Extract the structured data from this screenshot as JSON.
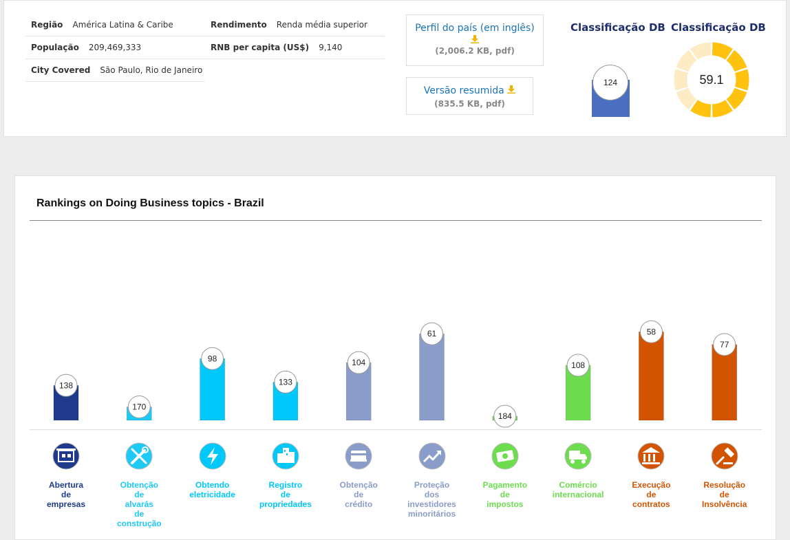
{
  "info": {
    "rows": [
      {
        "label": "Região",
        "value": "América Latina & Caribe"
      },
      {
        "label": "População",
        "value": "209,469,333"
      },
      {
        "label": "City Covered",
        "value": "São Paulo, Rio de Janeiro"
      },
      {
        "label": "Rendimento",
        "value": "Renda média superior"
      },
      {
        "label": "RNB per capita (US$)",
        "value": "9,140"
      }
    ]
  },
  "downloads": [
    {
      "title": "Perfil do país (em inglês)",
      "meta": "(2,006.2 KB, pdf)",
      "icon": "download-icon"
    },
    {
      "title": "Versão resumida",
      "meta": "(835.5 KB, pdf)",
      "icon": "download-icon"
    }
  ],
  "classification": {
    "rank_title": "Classificação DB",
    "rank_value": "124",
    "score_title": "Classificação DB",
    "score_value": "59.1",
    "score_fraction": 0.591,
    "colors": {
      "bar": "#4a6ec0",
      "donut_fill": "#ffc20e",
      "donut_empty": "#fdebc3"
    }
  },
  "chart_data": {
    "type": "bar",
    "title": "Rankings on Doing Business topics - Brazil",
    "ylim": [
      190,
      0
    ],
    "categories": [
      "Abertura de empresas",
      "Obtenção de alvarás de construção",
      "Obtendo eletricidade",
      "Registro de propriedades",
      "Obtenção de crédito",
      "Proteção dos investidores minoritários",
      "Pagamento de impostos",
      "Comércio internacional",
      "Execução de contratos",
      "Resolução de Insolvência"
    ],
    "values": [
      138,
      170,
      98,
      133,
      104,
      61,
      184,
      108,
      58,
      77
    ],
    "colors": [
      "#1f3a8a",
      "#1ec9f5",
      "#00c8fa",
      "#00c8fa",
      "#8a9cc9",
      "#8a9cc9",
      "#6ddc4f",
      "#6ddc4f",
      "#d35400",
      "#d35400"
    ]
  },
  "topics": [
    {
      "lines": [
        "Abertura",
        "de",
        "empresas"
      ],
      "icon": "building-icon",
      "color": "#1f3a8a"
    },
    {
      "lines": [
        "Obtenção",
        "de",
        "alvarás",
        "de",
        "construção"
      ],
      "icon": "tools-icon",
      "color": "#1ec9f5"
    },
    {
      "lines": [
        "Obtendo",
        "eletricidade"
      ],
      "icon": "lightning-icon",
      "color": "#00c8fa"
    },
    {
      "lines": [
        "Registro",
        "de",
        "propriedades"
      ],
      "icon": "buildings-icon",
      "color": "#00c8fa"
    },
    {
      "lines": [
        "Obtenção",
        "de",
        "crédito"
      ],
      "icon": "credit-card-icon",
      "color": "#8a9cc9"
    },
    {
      "lines": [
        "Proteção",
        "dos",
        "investidores",
        "minoritários"
      ],
      "icon": "trend-up-icon",
      "color": "#8a9cc9"
    },
    {
      "lines": [
        "Pagamento",
        "de",
        "impostos"
      ],
      "icon": "money-icon",
      "color": "#6ddc4f"
    },
    {
      "lines": [
        "Comércio",
        "internacional"
      ],
      "icon": "truck-icon",
      "color": "#6ddc4f"
    },
    {
      "lines": [
        "Execução",
        "de",
        "contratos"
      ],
      "icon": "courthouse-icon",
      "color": "#d35400"
    },
    {
      "lines": [
        "Resolução",
        "de",
        "Insolvência"
      ],
      "icon": "gavel-icon",
      "color": "#d35400"
    }
  ]
}
